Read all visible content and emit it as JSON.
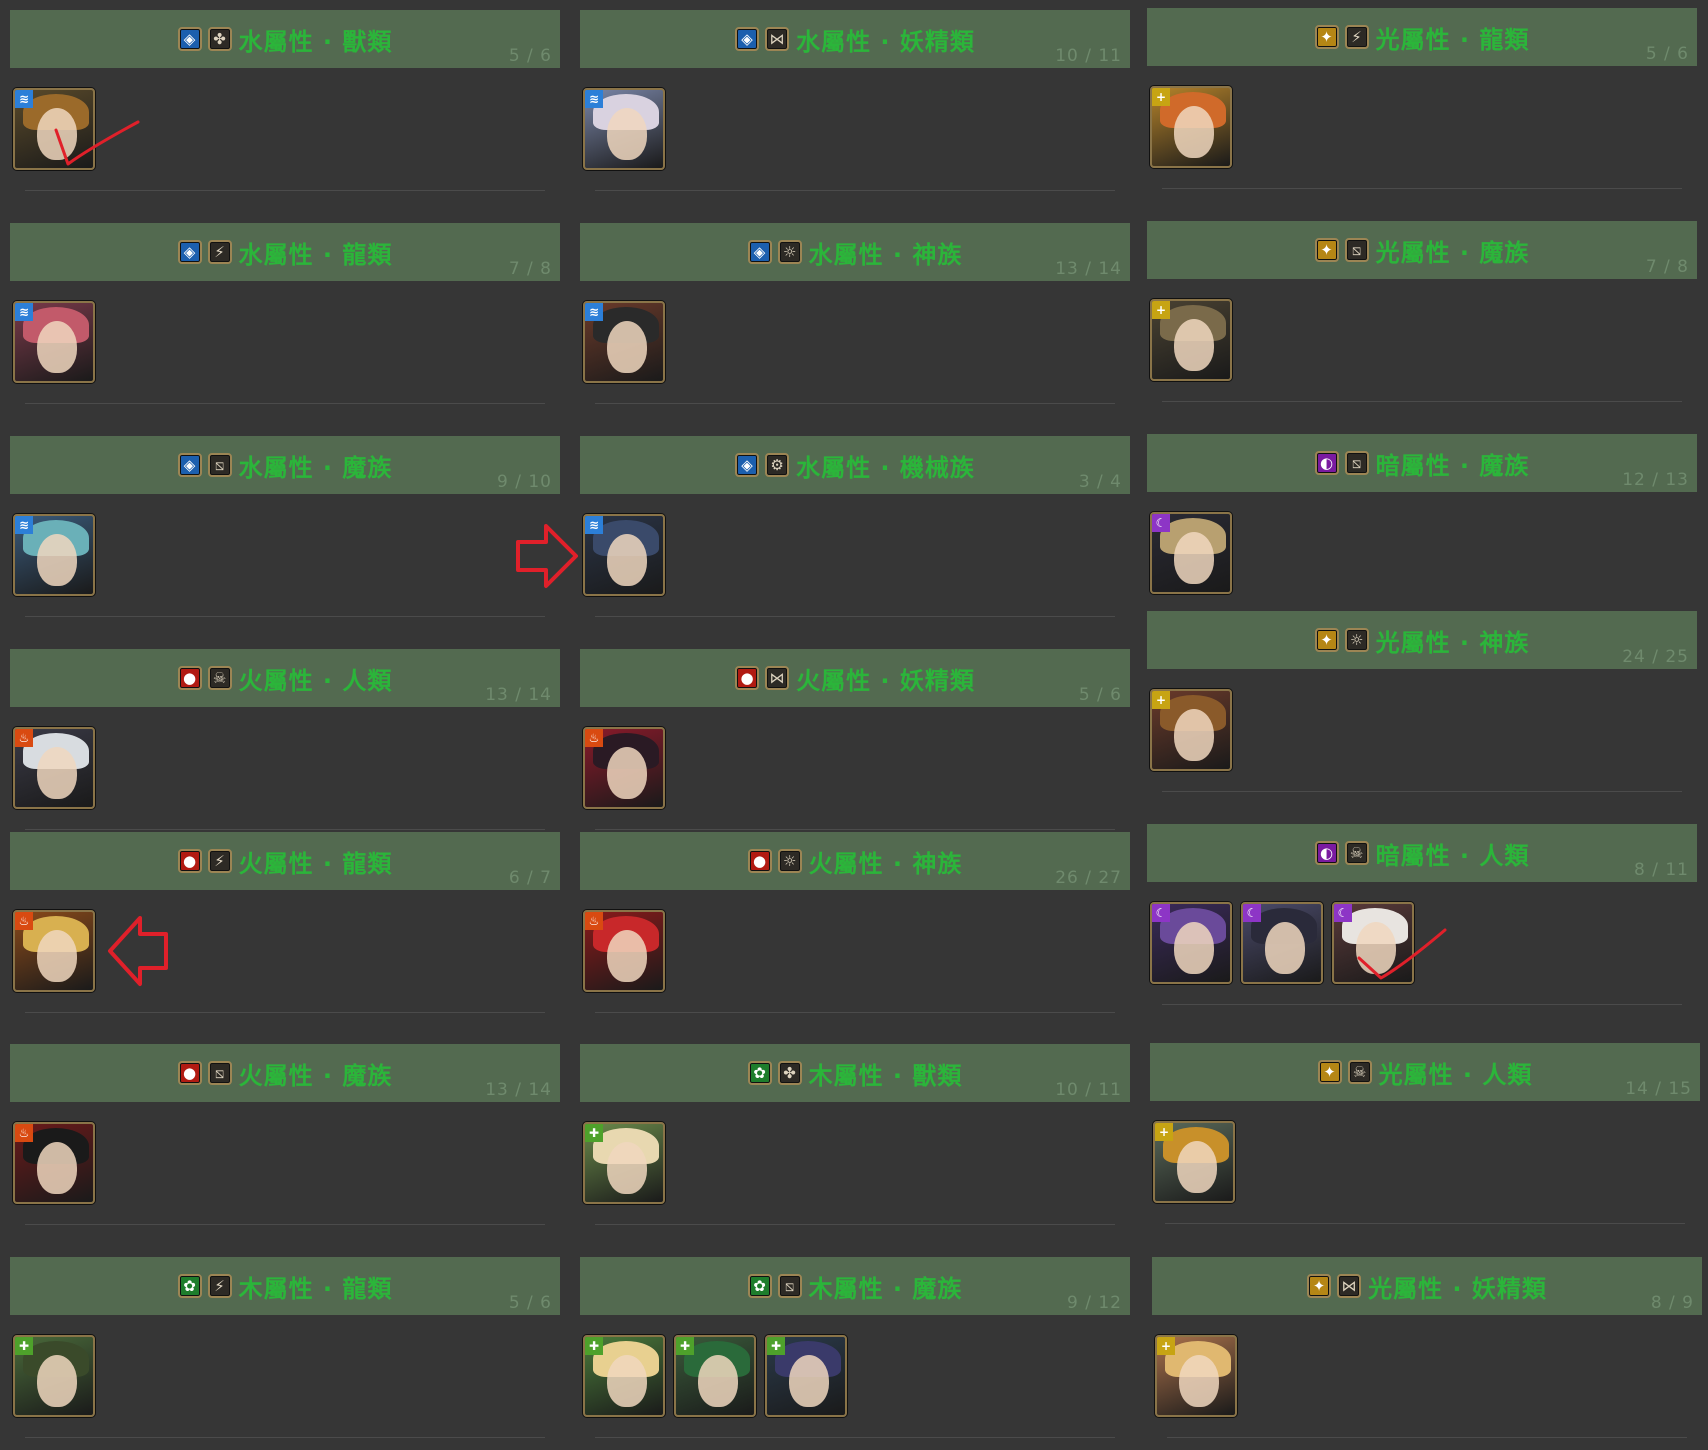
{
  "colors": {
    "background": "#363636",
    "header_bg": "#536a50",
    "title_green": "#2bb53a",
    "count_green": "#6f8a6d",
    "annotation_red": "#e0202a",
    "water": "#1c5fae",
    "fire": "#b11a12",
    "wood": "#1e7d2c",
    "light": "#b58615",
    "dark": "#7a1aa0"
  },
  "race_icons": {
    "beast": "paw-icon",
    "dragon": "claw-icon",
    "demon": "slash-icon",
    "fairy": "butterfly-icon",
    "god": "sun-icon",
    "machine": "gear-icon",
    "human": "skull-icon"
  },
  "sections": [
    {
      "id": "water-beast",
      "element": "water",
      "race": "beast",
      "title": "水屬性 · 獸類",
      "count": "5 / 6",
      "cards": [
        {
          "element": "water",
          "hair": "#9b6a2a",
          "bg": "#5a4a2a"
        }
      ]
    },
    {
      "id": "water-fairy",
      "element": "water",
      "race": "fairy",
      "title": "水屬性 · 妖精類",
      "count": "10 / 11",
      "cards": [
        {
          "element": "water",
          "hair": "#d9d2e0",
          "bg": "#7a86a8"
        }
      ]
    },
    {
      "id": "light-dragon",
      "element": "light",
      "race": "dragon",
      "title": "光屬性 · 龍類",
      "count": "5 / 6",
      "cards": [
        {
          "element": "light",
          "hair": "#d06a2a",
          "bg": "#b5832a"
        }
      ]
    },
    {
      "id": "water-dragon",
      "element": "water",
      "race": "dragon",
      "title": "水屬性 · 龍類",
      "count": "7 / 8",
      "cards": [
        {
          "element": "water",
          "hair": "#c25a6a",
          "bg": "#7a3a4a"
        }
      ]
    },
    {
      "id": "water-god",
      "element": "water",
      "race": "god",
      "title": "水屬性 · 神族",
      "count": "13 / 14",
      "cards": [
        {
          "element": "water",
          "hair": "#2a2a2a",
          "bg": "#6a3a2a"
        }
      ]
    },
    {
      "id": "light-demon",
      "element": "light",
      "race": "demon",
      "title": "光屬性 · 魔族",
      "count": "7 / 8",
      "cards": [
        {
          "element": "light",
          "hair": "#7a6a4a",
          "bg": "#4a4232"
        }
      ]
    },
    {
      "id": "water-demon",
      "element": "water",
      "race": "demon",
      "title": "水屬性 · 魔族",
      "count": "9 / 10",
      "cards": [
        {
          "element": "water",
          "hair": "#6ab0b8",
          "bg": "#3a5a7a"
        }
      ]
    },
    {
      "id": "water-machine",
      "element": "water",
      "race": "machine",
      "title": "水屬性 · 機械族",
      "count": "3 / 4",
      "cards": [
        {
          "element": "water",
          "hair": "#3a4a6a",
          "bg": "#2a3446"
        }
      ]
    },
    {
      "id": "dark-demon",
      "element": "dark",
      "race": "demon",
      "title": "暗屬性 · 魔族",
      "count": "12 / 13",
      "cards": [
        {
          "element": "dark",
          "hair": "#b8a070",
          "bg": "#2a2a34"
        }
      ]
    },
    {
      "id": "light-god",
      "element": "light",
      "race": "god",
      "title": "光屬性 · 神族",
      "count": "24 / 25",
      "cards": [
        {
          "element": "light",
          "hair": "#8a5a2a",
          "bg": "#6a3a2a"
        }
      ]
    },
    {
      "id": "fire-human",
      "element": "fire",
      "race": "human",
      "title": "火屬性 · 人類",
      "count": "13 / 14",
      "cards": [
        {
          "element": "fire",
          "hair": "#d8dce0",
          "bg": "#3a3a46"
        }
      ]
    },
    {
      "id": "fire-fairy",
      "element": "fire",
      "race": "fairy",
      "title": "火屬性 · 妖精類",
      "count": "5 / 6",
      "cards": [
        {
          "element": "fire",
          "hair": "#2a1a24",
          "bg": "#8a1a2a"
        }
      ]
    },
    {
      "id": "dark-human",
      "element": "dark",
      "race": "human",
      "title": "暗屬性 · 人類",
      "count": "8 / 11",
      "cards": [
        {
          "element": "dark",
          "hair": "#6a4a9a",
          "bg": "#3a2a5a"
        },
        {
          "element": "dark",
          "hair": "#2a2a3a",
          "bg": "#4a4a6a"
        },
        {
          "element": "dark",
          "hair": "#e8e4e0",
          "bg": "#5a3a3a"
        }
      ]
    },
    {
      "id": "fire-dragon",
      "element": "fire",
      "race": "dragon",
      "title": "火屬性 · 龍類",
      "count": "6 / 7",
      "cards": [
        {
          "element": "fire",
          "hair": "#d8b050",
          "bg": "#8a4a1a"
        }
      ]
    },
    {
      "id": "fire-god",
      "element": "fire",
      "race": "god",
      "title": "火屬性 · 神族",
      "count": "26 / 27",
      "cards": [
        {
          "element": "fire",
          "hair": "#c8282a",
          "bg": "#8a1a1a"
        }
      ]
    },
    {
      "id": "fire-demon",
      "element": "fire",
      "race": "demon",
      "title": "火屬性 · 魔族",
      "count": "13 / 14",
      "cards": [
        {
          "element": "fire",
          "hair": "#1a1a1a",
          "bg": "#6a1a1a"
        }
      ]
    },
    {
      "id": "wood-beast",
      "element": "wood",
      "race": "beast",
      "title": "木屬性 · 獸類",
      "count": "10 / 11",
      "cards": [
        {
          "element": "wood",
          "hair": "#e8d8b0",
          "bg": "#6a8a4a"
        }
      ]
    },
    {
      "id": "light-human",
      "element": "light",
      "race": "human",
      "title": "光屬性 · 人類",
      "count": "14 / 15",
      "cards": [
        {
          "element": "light",
          "hair": "#c8902a",
          "bg": "#5a6a5a"
        }
      ]
    },
    {
      "id": "wood-dragon",
      "element": "wood",
      "race": "dragon",
      "title": "木屬性 · 龍類",
      "count": "5 / 6",
      "cards": [
        {
          "element": "wood",
          "hair": "#3a4a2a",
          "bg": "#4a6a3a"
        }
      ]
    },
    {
      "id": "wood-demon",
      "element": "wood",
      "race": "demon",
      "title": "木屬性 · 魔族",
      "count": "9 / 12",
      "cards": [
        {
          "element": "wood",
          "hair": "#e8d090",
          "bg": "#4a7a3a"
        },
        {
          "element": "wood",
          "hair": "#2a6a3a",
          "bg": "#3a5a3a"
        },
        {
          "element": "wood",
          "hair": "#3a3a6a",
          "bg": "#2a3a4a"
        }
      ]
    },
    {
      "id": "light-fairy",
      "element": "light",
      "race": "fairy",
      "title": "光屬性 · 妖精類",
      "count": "8 / 9",
      "cards": [
        {
          "element": "light",
          "hair": "#e0b870",
          "bg": "#a8704a"
        }
      ]
    }
  ]
}
